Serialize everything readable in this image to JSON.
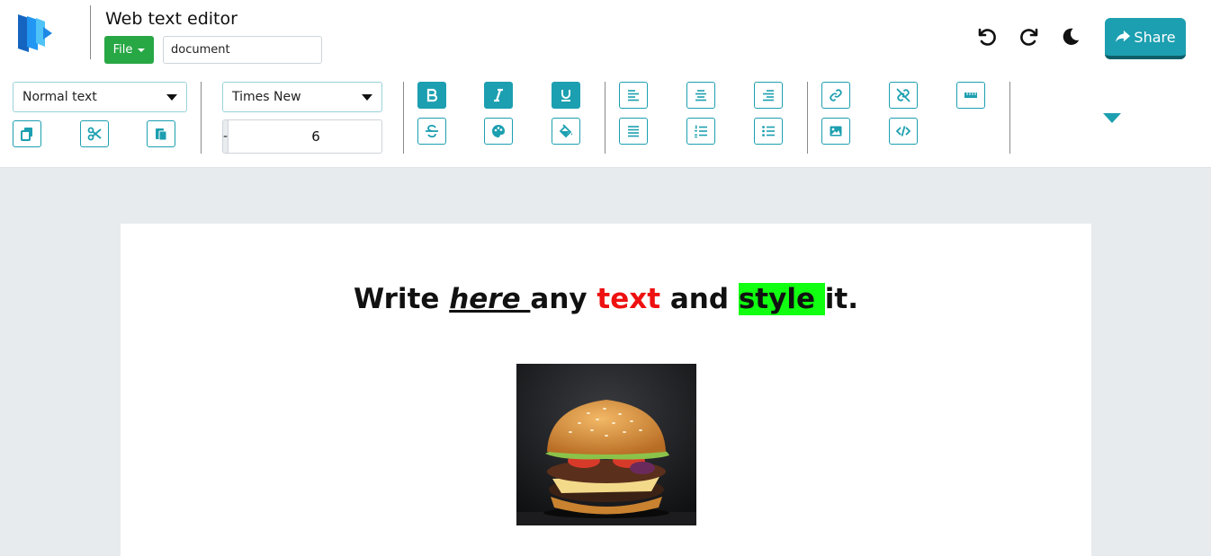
{
  "app": {
    "title": "Web text editor",
    "file_menu": "File",
    "document_name": "document"
  },
  "actions": {
    "undo": "undo-icon",
    "redo": "redo-icon",
    "theme": "moon-icon",
    "share_label": "Share"
  },
  "toolbar": {
    "block_style": "Normal text",
    "font_family": "Times New",
    "font_size": "6",
    "decrease_label": "-",
    "increase_label": "+",
    "accent_color": "#1c9fb0"
  },
  "document": {
    "line": [
      {
        "text": "Write ",
        "style": "normal"
      },
      {
        "text": "here ",
        "style": "italic-underline"
      },
      {
        "text": "any ",
        "style": "normal"
      },
      {
        "text": "text",
        "style": "red"
      },
      {
        "text": " and ",
        "style": "normal"
      },
      {
        "text": "style ",
        "style": "highlight"
      },
      {
        "text": "it.",
        "style": "normal"
      }
    ],
    "text_color": "#ee1111",
    "highlight_color": "#11ff11"
  }
}
